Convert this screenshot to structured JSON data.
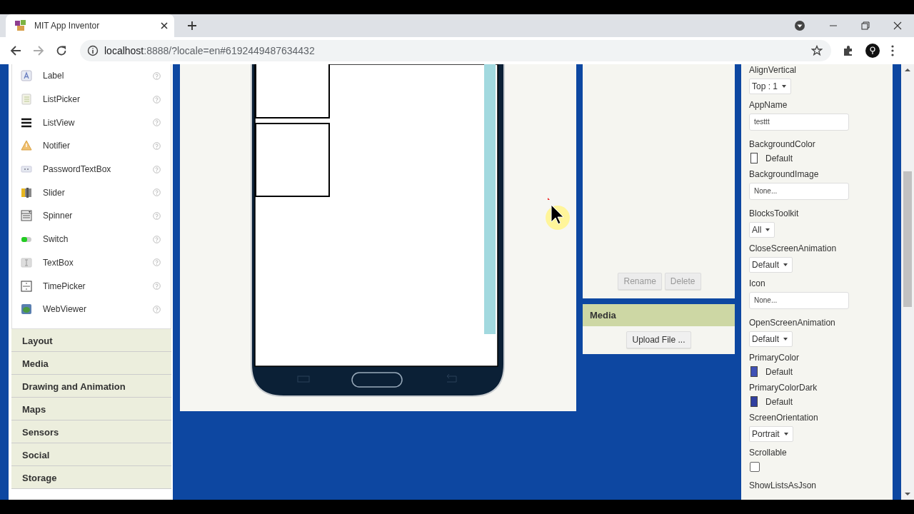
{
  "browser": {
    "tab": {
      "title": "MIT App Inventor",
      "selected": true
    },
    "address": {
      "host": "localhost",
      "rest": ":8888/?locale=en#6192449487634432"
    }
  },
  "palette": {
    "items": [
      {
        "label": "Label",
        "kind": "label"
      },
      {
        "label": "ListPicker",
        "kind": "listpicker"
      },
      {
        "label": "ListView",
        "kind": "listview"
      },
      {
        "label": "Notifier",
        "kind": "notifier"
      },
      {
        "label": "PasswordTextBox",
        "kind": "password"
      },
      {
        "label": "Slider",
        "kind": "slider"
      },
      {
        "label": "Spinner",
        "kind": "spinner"
      },
      {
        "label": "Switch",
        "kind": "switch"
      },
      {
        "label": "TextBox",
        "kind": "textbox"
      },
      {
        "label": "TimePicker",
        "kind": "timepicker"
      },
      {
        "label": "WebViewer",
        "kind": "webviewer"
      }
    ],
    "categories": [
      "Layout",
      "Media",
      "Drawing and Animation",
      "Maps",
      "Sensors",
      "Social",
      "Storage"
    ]
  },
  "components": {
    "buttons": [
      {
        "label": "Rename",
        "disabled": true
      },
      {
        "label": "Delete",
        "disabled": true
      }
    ]
  },
  "media": {
    "title": "Media",
    "button": "Upload File ..."
  },
  "properties": [
    {
      "name": "AlignVertical",
      "kind": "select",
      "value": "Top : 1"
    },
    {
      "name": "AppName",
      "kind": "text",
      "value": "testtt"
    },
    {
      "name": "BackgroundColor",
      "kind": "color",
      "value": "Default",
      "color": "#ffffff"
    },
    {
      "name": "BackgroundImage",
      "kind": "text",
      "value": "None..."
    },
    {
      "name": "BlocksToolkit",
      "kind": "select",
      "value": "All"
    },
    {
      "name": "CloseScreenAnimation",
      "kind": "select",
      "value": "Default"
    },
    {
      "name": "Icon",
      "kind": "text",
      "value": "None..."
    },
    {
      "name": "OpenScreenAnimation",
      "kind": "select",
      "value": "Default"
    },
    {
      "name": "PrimaryColor",
      "kind": "color",
      "value": "Default",
      "color": "#3f51b5"
    },
    {
      "name": "PrimaryColorDark",
      "kind": "color",
      "value": "Default",
      "color": "#303f9f"
    },
    {
      "name": "ScreenOrientation",
      "kind": "select",
      "value": "Portrait"
    },
    {
      "name": "Scrollable",
      "kind": "checkbox",
      "checked": false
    },
    {
      "name": "ShowListsAsJson",
      "kind": "none"
    }
  ]
}
